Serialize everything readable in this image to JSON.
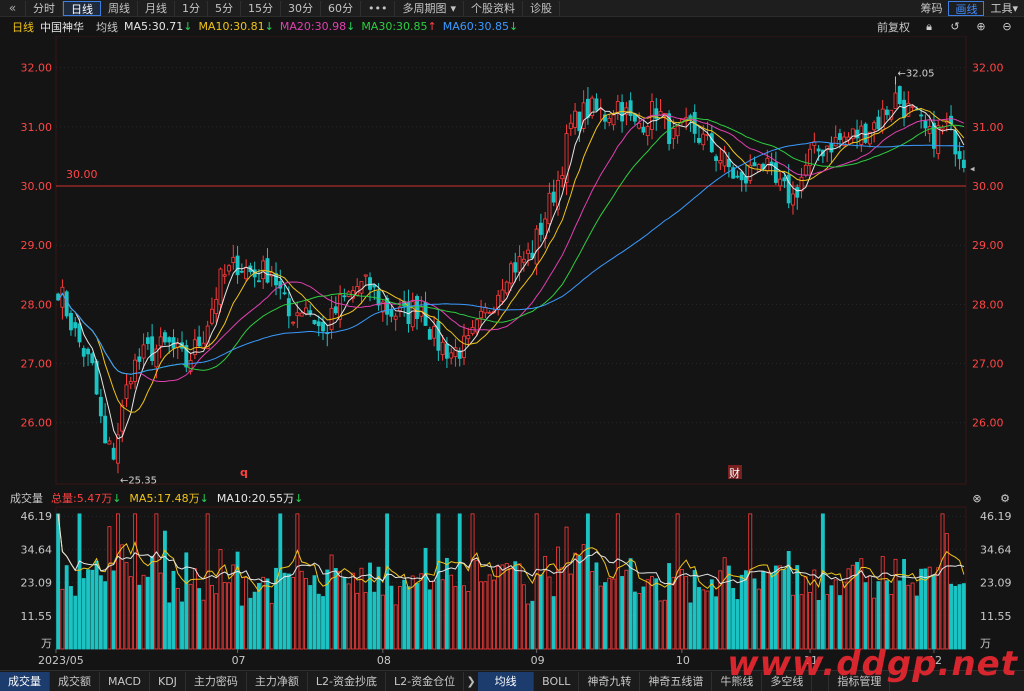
{
  "toolbar": {
    "collapse_icon": "double-chevron-left-icon",
    "tabs": [
      {
        "label": "分时",
        "active": false
      },
      {
        "label": "日线",
        "active": true
      },
      {
        "label": "周线",
        "active": false
      },
      {
        "label": "月线",
        "active": false
      },
      {
        "label": "1分",
        "active": false
      },
      {
        "label": "5分",
        "active": false
      },
      {
        "label": "15分",
        "active": false
      },
      {
        "label": "30分",
        "active": false
      },
      {
        "label": "60分",
        "active": false
      },
      {
        "label": "•••",
        "active": false
      },
      {
        "label": "多周期图",
        "active": false
      },
      {
        "label": "个股资料",
        "active": false
      },
      {
        "label": "诊股",
        "active": false
      }
    ],
    "multi_period_caret": "▾",
    "right": [
      {
        "label": "筹码",
        "active": false
      },
      {
        "label": "画线",
        "active": true
      },
      {
        "label": "工具▾",
        "active": false
      }
    ]
  },
  "ma_row": {
    "period": "日线",
    "stock_name": "中国神华",
    "line_type": "均线",
    "items": [
      {
        "label": "MA5:30.71",
        "arrow": "↓",
        "color": "#e6e6e6",
        "arrow_color": "#2ad35a"
      },
      {
        "label": "MA10:30.81",
        "arrow": "↓",
        "color": "#f0c419",
        "arrow_color": "#2ad35a"
      },
      {
        "label": "MA20:30.98",
        "arrow": "↓",
        "color": "#e040b0",
        "arrow_color": "#2ad35a"
      },
      {
        "label": "MA30:30.85",
        "arrow": "↑",
        "color": "#2ecc40",
        "arrow_color": "#ff4040"
      },
      {
        "label": "MA60:30.85",
        "arrow": "↓",
        "color": "#3a9aff",
        "arrow_color": "#2ad35a"
      }
    ],
    "adjust": "前复权"
  },
  "price_axis": {
    "labels": [
      "32.00",
      "31.00",
      "30.00",
      "29.00",
      "28.00",
      "27.00",
      "26.00"
    ],
    "values": [
      32,
      31,
      30,
      29,
      28,
      27,
      26
    ],
    "min": 25.1,
    "max": 32.4,
    "ref_line_value": 30.0,
    "ref_line_label": "30.00",
    "high_label": "32.05",
    "low_label": "25.35",
    "marker_q": "q",
    "marker_cai": "财"
  },
  "volume": {
    "title": "成交量",
    "total_label": "总量:5.47万",
    "total_arrow": "↓",
    "ma5_label": "MA5:17.48万",
    "ma5_arrow": "↓",
    "ma10_label": "MA10:20.55万",
    "ma10_arrow": "↓",
    "axis_labels": [
      "46.19",
      "34.64",
      "23.09",
      "11.55",
      "万"
    ],
    "axis_values": [
      46.19,
      34.64,
      23.09,
      11.55
    ],
    "max": 48.0
  },
  "x_axis": {
    "labels": [
      "2023/05",
      "07",
      "08",
      "09",
      "10",
      "11",
      "12"
    ],
    "bar_index": [
      0,
      42,
      76,
      112,
      146,
      176,
      205
    ]
  },
  "colors": {
    "up": "#ff3b3b",
    "down": "#1bc3c3",
    "ma5": "#e6e6e6",
    "ma10": "#f0c419",
    "ma20": "#e040b0",
    "ma30": "#2ecc40",
    "ma60": "#3a9aff"
  },
  "bottom_tabs": {
    "left": [
      "成交量",
      "成交额",
      "MACD",
      "KDJ",
      "主力密码",
      "主力净额",
      "L2-资金抄底",
      "L2-资金仓位"
    ],
    "left_active": 0,
    "arrow": "❯",
    "right": [
      "均线",
      "BOLL",
      "神奇九转",
      "神奇五线谱",
      "牛熊线",
      "多空线",
      "",
      "指标管理"
    ],
    "right_active": 0
  },
  "watermark": "www.ddgp.net",
  "chart_data": {
    "type": "candlestick",
    "title": "",
    "series_kind": "daily K-line with moving averages and volume",
    "keypoints": [
      [
        0,
        28.3
      ],
      [
        4,
        27.5
      ],
      [
        8,
        26.9
      ],
      [
        11,
        25.6
      ],
      [
        13,
        25.5
      ],
      [
        17,
        26.9
      ],
      [
        21,
        27.2
      ],
      [
        26,
        27.3
      ],
      [
        30,
        27.0
      ],
      [
        34,
        27.5
      ],
      [
        38,
        28.4
      ],
      [
        42,
        28.7
      ],
      [
        46,
        28.5
      ],
      [
        50,
        28.6
      ],
      [
        54,
        27.8
      ],
      [
        58,
        28.0
      ],
      [
        62,
        27.5
      ],
      [
        66,
        28.0
      ],
      [
        70,
        28.3
      ],
      [
        73,
        28.3
      ],
      [
        77,
        27.9
      ],
      [
        81,
        27.8
      ],
      [
        85,
        28.0
      ],
      [
        88,
        27.4
      ],
      [
        92,
        27.2
      ],
      [
        96,
        27.3
      ],
      [
        99,
        27.7
      ],
      [
        102,
        28.1
      ],
      [
        105,
        28.6
      ],
      [
        108,
        28.7
      ],
      [
        111,
        28.9
      ],
      [
        114,
        29.5
      ],
      [
        117,
        30.1
      ],
      [
        120,
        31.0
      ],
      [
        124,
        31.3
      ],
      [
        128,
        31.2
      ],
      [
        131,
        31.4
      ],
      [
        135,
        31.0
      ],
      [
        140,
        31.3
      ],
      [
        144,
        30.8
      ],
      [
        148,
        31.0
      ],
      [
        152,
        30.7
      ],
      [
        156,
        30.4
      ],
      [
        160,
        30.0
      ],
      [
        164,
        30.5
      ],
      [
        168,
        30.0
      ],
      [
        172,
        29.8
      ],
      [
        176,
        30.5
      ],
      [
        180,
        30.7
      ],
      [
        184,
        30.8
      ],
      [
        188,
        30.9
      ],
      [
        192,
        31.1
      ],
      [
        196,
        31.5
      ],
      [
        200,
        31.2
      ],
      [
        204,
        30.8
      ],
      [
        208,
        31.0
      ],
      [
        212,
        30.5
      ]
    ],
    "bar_count": 213,
    "moving_averages": [
      "MA5",
      "MA10",
      "MA20",
      "MA30",
      "MA60"
    ],
    "high": 32.05,
    "low": 25.35
  }
}
